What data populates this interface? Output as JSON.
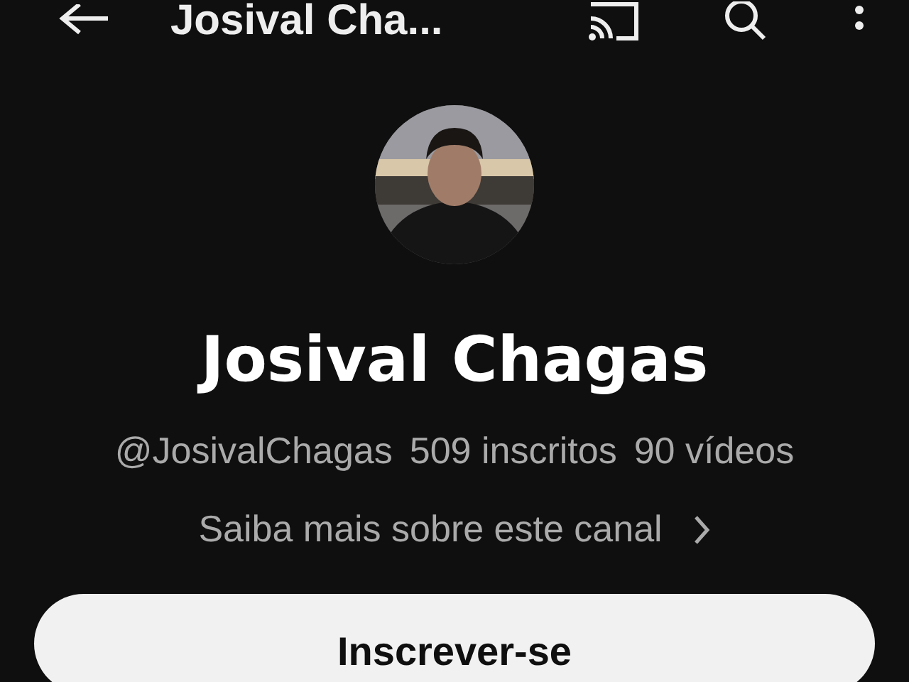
{
  "top_bar": {
    "title": "Josival Cha..."
  },
  "channel": {
    "name": "Josival Chagas",
    "stats": [
      "@JosivalChagas",
      "509 inscritos",
      "90 vídeos"
    ],
    "about_link": "Saiba mais sobre este canal"
  },
  "subscribe_button": {
    "label": "Inscrever-se"
  }
}
